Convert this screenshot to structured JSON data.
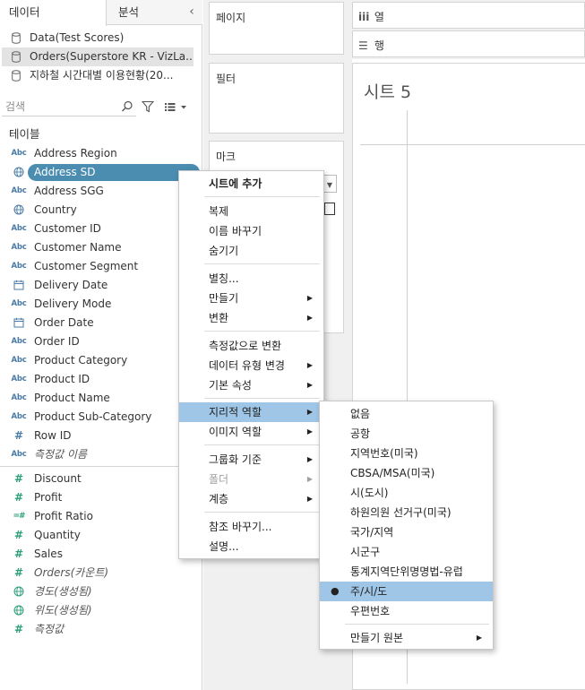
{
  "tabs": {
    "data": "데이터",
    "analysis": "분석"
  },
  "data_sources": [
    {
      "label": "Data(Test Scores)",
      "selected": false
    },
    {
      "label": "Orders(Superstore KR - VizLa...",
      "selected": true
    },
    {
      "label": "지하철 시간대별 이용현황(20...",
      "selected": false
    }
  ],
  "search": {
    "placeholder": "검색"
  },
  "tables_header": "테이블",
  "dimensions": [
    {
      "label": "Address Region",
      "icon": "abc"
    },
    {
      "label": "Address SD",
      "icon": "globe"
    },
    {
      "label": "Address SGG",
      "icon": "abc"
    },
    {
      "label": "Country",
      "icon": "globe"
    },
    {
      "label": "Customer ID",
      "icon": "abc"
    },
    {
      "label": "Customer Name",
      "icon": "abc"
    },
    {
      "label": "Customer Segment",
      "icon": "abc"
    },
    {
      "label": "Delivery Date",
      "icon": "calendar"
    },
    {
      "label": "Delivery Mode",
      "icon": "abc"
    },
    {
      "label": "Order Date",
      "icon": "calendar"
    },
    {
      "label": "Order ID",
      "icon": "abc"
    },
    {
      "label": "Product Category",
      "icon": "abc"
    },
    {
      "label": "Product ID",
      "icon": "abc"
    },
    {
      "label": "Product Name",
      "icon": "abc"
    },
    {
      "label": "Product Sub-Category",
      "icon": "abc"
    },
    {
      "label": "Row ID",
      "icon": "hash-blue"
    },
    {
      "label": "측정값 이름",
      "icon": "abc"
    }
  ],
  "measures": [
    {
      "label": "Discount",
      "icon": "hash"
    },
    {
      "label": "Profit",
      "icon": "hash"
    },
    {
      "label": "Profit Ratio",
      "icon": "ratio"
    },
    {
      "label": "Quantity",
      "icon": "hash"
    },
    {
      "label": "Sales",
      "icon": "hash"
    },
    {
      "label": "Orders(카운트)",
      "icon": "hash"
    },
    {
      "label": "경도(생성됨)",
      "icon": "globe-green"
    },
    {
      "label": "위도(생성됨)",
      "icon": "globe-green"
    },
    {
      "label": "측정값",
      "icon": "hash"
    }
  ],
  "cards": {
    "pages": "페이지",
    "filters": "필터",
    "marks": "마크"
  },
  "shelves": {
    "columns": "열",
    "rows": "행"
  },
  "sheet_title": "시트 5",
  "context_menu": {
    "add_to_sheet": "시트에 추가",
    "duplicate": "복제",
    "rename": "이름 바꾸기",
    "hide": "숨기기",
    "aliases": "별칭...",
    "create": "만들기",
    "transform": "변환",
    "convert_to_measure": "측정값으로 변환",
    "change_data_type": "데이터 유형 변경",
    "default_properties": "기본 속성",
    "geographic_role": "지리적 역할",
    "image_role": "이미지 역할",
    "group_by": "그룹화 기준",
    "folders": "폴더",
    "hierarchy": "계층",
    "replace_references": "참조 바꾸기...",
    "describe": "설명..."
  },
  "geo_menu": {
    "items": [
      "없음",
      "공항",
      "지역번호(미국)",
      "CBSA/MSA(미국)",
      "시(도시)",
      "하원의원 선거구(미국)",
      "국가/지역",
      "시군구",
      "통계지역단위명명법-유럽",
      "주/시/도",
      "우편번호"
    ],
    "checked": "주/시/도",
    "create_from": "만들기 원본"
  },
  "colors": {
    "highlight": "#4a8db0",
    "menu_active": "#9fc6e7",
    "string_icon": "#4a7ba6",
    "measure_icon": "#2b9e7a"
  }
}
